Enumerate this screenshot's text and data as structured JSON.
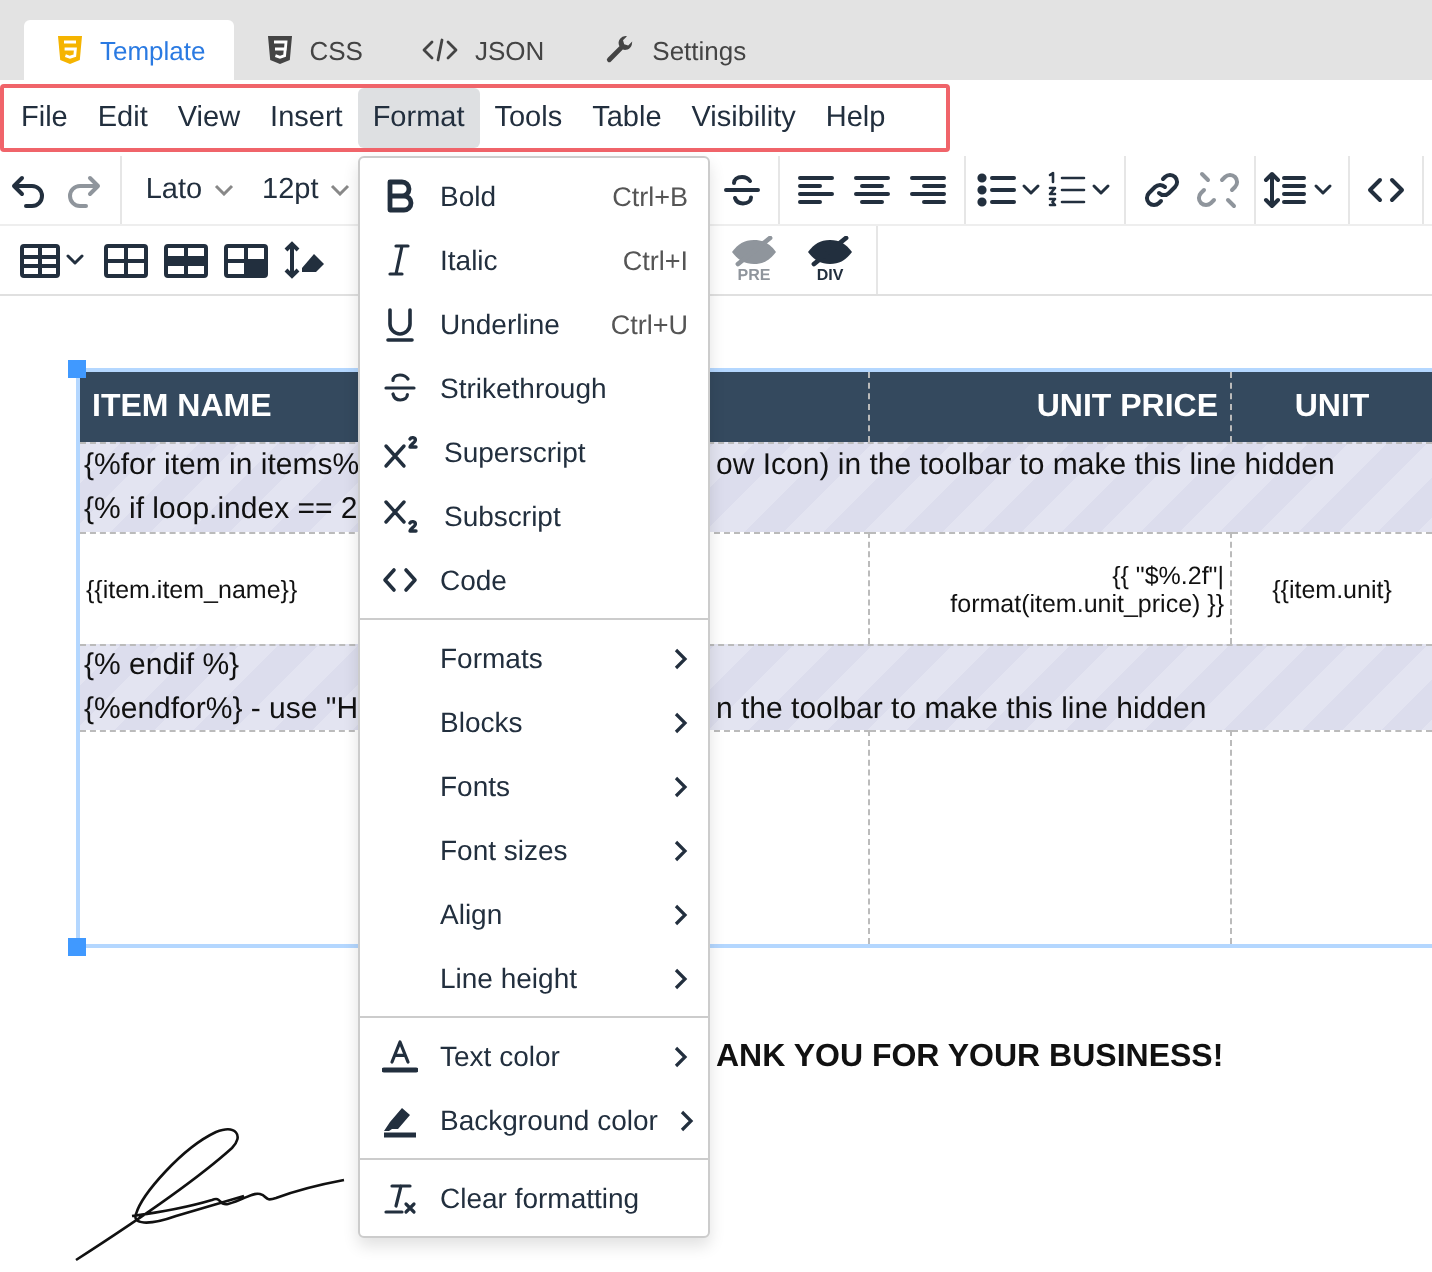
{
  "tabs": [
    {
      "label": "Template",
      "selected": true
    },
    {
      "label": "CSS",
      "selected": false
    },
    {
      "label": "JSON",
      "selected": false
    },
    {
      "label": "Settings",
      "selected": false
    }
  ],
  "menubar": [
    {
      "label": "File",
      "selected": false
    },
    {
      "label": "Edit",
      "selected": false
    },
    {
      "label": "View",
      "selected": false
    },
    {
      "label": "Insert",
      "selected": false
    },
    {
      "label": "Format",
      "selected": true
    },
    {
      "label": "Tools",
      "selected": false
    },
    {
      "label": "Table",
      "selected": false
    },
    {
      "label": "Visibility",
      "selected": false
    },
    {
      "label": "Help",
      "selected": false
    }
  ],
  "toolbar": {
    "font": "Lato",
    "font_size": "12pt",
    "row_1": [
      {
        "kind": "undo",
        "disabled": false
      },
      {
        "kind": "redo",
        "disabled": true
      },
      {
        "kind": "gap"
      },
      {
        "kind": "strike",
        "disabled": false
      },
      {
        "kind": "sep"
      },
      {
        "kind": "align-left",
        "disabled": false
      },
      {
        "kind": "align-center",
        "disabled": false
      },
      {
        "kind": "align-right",
        "disabled": false
      },
      {
        "kind": "sep"
      },
      {
        "kind": "bullets",
        "disabled": false
      },
      {
        "kind": "numbers",
        "disabled": false
      },
      {
        "kind": "sep"
      },
      {
        "kind": "link",
        "disabled": false
      },
      {
        "kind": "unlink",
        "disabled": true
      },
      {
        "kind": "sep"
      },
      {
        "kind": "line-height",
        "disabled": false
      },
      {
        "kind": "sep"
      },
      {
        "kind": "code",
        "disabled": false
      },
      {
        "kind": "sep"
      }
    ],
    "row_2": [
      {
        "kind": "table",
        "disabled": false
      },
      {
        "kind": "table-a",
        "disabled": false
      },
      {
        "kind": "table-b",
        "disabled": false
      },
      {
        "kind": "table-c",
        "disabled": false
      },
      {
        "kind": "cell",
        "disabled": false
      },
      {
        "kind": "gap"
      },
      {
        "kind": "hide",
        "label": "PRE",
        "disabled": true
      },
      {
        "kind": "hide",
        "label": "DIV",
        "disabled": false
      }
    ]
  },
  "format_menu": [
    [
      {
        "kind": "bold",
        "label": "Bold",
        "shortcut": "Ctrl+B"
      },
      {
        "kind": "italic",
        "label": "Italic",
        "shortcut": "Ctrl+I"
      },
      {
        "kind": "underline",
        "label": "Underline",
        "shortcut": "Ctrl+U"
      },
      {
        "kind": "strike",
        "label": "Strikethrough"
      },
      {
        "kind": "sup",
        "label": "Superscript"
      },
      {
        "kind": "sub",
        "label": "Subscript"
      },
      {
        "kind": "code",
        "label": "Code"
      }
    ],
    [
      {
        "kind": "none",
        "label": "Formats",
        "submenu": true
      },
      {
        "kind": "none",
        "label": "Blocks",
        "submenu": true
      },
      {
        "kind": "none",
        "label": "Fonts",
        "submenu": true
      },
      {
        "kind": "none",
        "label": "Font sizes",
        "submenu": true
      },
      {
        "kind": "none",
        "label": "Align",
        "submenu": true
      },
      {
        "kind": "none",
        "label": "Line height",
        "submenu": true
      }
    ],
    [
      {
        "kind": "text-color",
        "label": "Text color",
        "submenu": true
      },
      {
        "kind": "bg-color",
        "label": "Background color",
        "submenu": true
      }
    ],
    [
      {
        "kind": "clear",
        "label": "Clear formatting"
      }
    ]
  ],
  "table": {
    "header": {
      "column_1": "ITEM NAME",
      "column_3": "UNIT PRICE",
      "column_4": "UNIT"
    },
    "rows": [
      {
        "kind": "template",
        "lines": [
          {
            "start": "{%for item in items%",
            "end": "ow Icon) in the toolbar to make this line hidden"
          },
          {
            "start": "{% if loop.index == 2"
          }
        ]
      },
      {
        "kind": "cells",
        "column_1": "{{item.item_name}}",
        "column_3": [
          "{{ \"$%.2f\"|",
          "format(item.unit_price) }}"
        ],
        "column_4": "{{item.unit}"
      },
      {
        "kind": "template",
        "lines": [
          {
            "start": "{% endif %}"
          },
          {
            "start": "{%endfor%} - use \"H",
            "end": "n the toolbar to make this line hidden"
          }
        ]
      },
      {
        "kind": "cells"
      }
    ]
  },
  "closing_text": "ANK YOU FOR YOUR BUSINESS!"
}
